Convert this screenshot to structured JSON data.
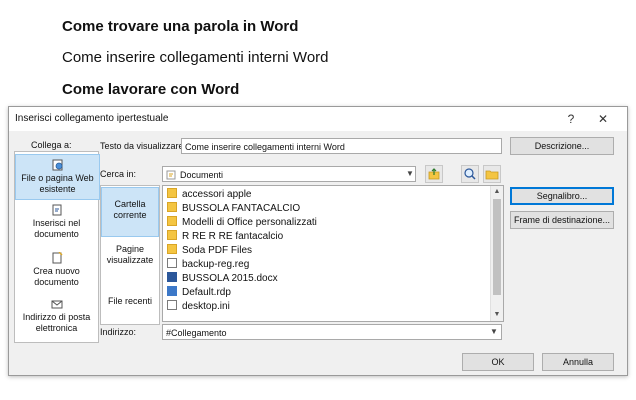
{
  "document": {
    "line1": "Come trovare una parola in Word",
    "line2": "Come inserire collegamenti interni Word",
    "line3": "Come lavorare con Word"
  },
  "dialog": {
    "title": "Inserisci collegamento ipertestuale",
    "help": "?",
    "close": "✕",
    "collega_label": "Collega a:",
    "left_items": [
      {
        "label": "File o pagina Web esistente",
        "icon": "globe-file-icon"
      },
      {
        "label": "Inserisci nel documento",
        "icon": "place-in-document-icon"
      },
      {
        "label": "Crea nuovo documento",
        "icon": "new-document-icon"
      },
      {
        "label": "Indirizzo di posta elettronica",
        "icon": "email-address-icon"
      }
    ],
    "testo_label": "Testo da visualizzare:",
    "testo_value": "Come inserire collegamenti interni Word",
    "descrizione_button": "Descrizione...",
    "cerca_label": "Cerca in:",
    "cerca_value": "Documenti",
    "segnalibro_button": "Segnalibro...",
    "frame_button": "Frame di destinazione...",
    "mid_items": [
      {
        "label": "Cartella corrente"
      },
      {
        "label": "Pagine visualizzate"
      },
      {
        "label": "File recenti"
      }
    ],
    "files": [
      {
        "name": "accessori apple",
        "type": "folder"
      },
      {
        "name": "BUSSOLA FANTACALCIO",
        "type": "folder"
      },
      {
        "name": "Modelli di Office personalizzati",
        "type": "folder"
      },
      {
        "name": "R RE R RE fantacalcio",
        "type": "folder"
      },
      {
        "name": "Soda PDF Files",
        "type": "folder"
      },
      {
        "name": "backup-reg.reg",
        "type": "reg"
      },
      {
        "name": "BUSSOLA 2015.docx",
        "type": "word"
      },
      {
        "name": "Default.rdp",
        "type": "rdp"
      },
      {
        "name": "desktop.ini",
        "type": "ini"
      }
    ],
    "indirizzo_label": "Indirizzo:",
    "indirizzo_value": "#Collegamento",
    "ok_button": "OK",
    "annulla_button": "Annulla"
  }
}
